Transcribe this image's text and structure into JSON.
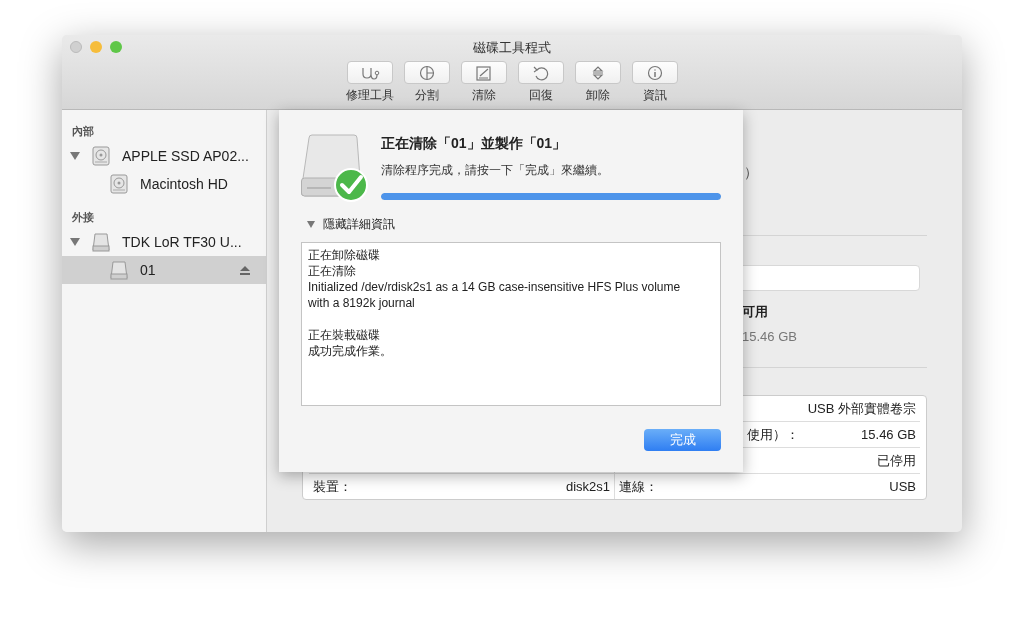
{
  "window": {
    "title": "磁碟工具程式"
  },
  "toolbar": [
    {
      "kind": "firstaid",
      "label": "修理工具"
    },
    {
      "kind": "partition",
      "label": "分割"
    },
    {
      "kind": "erase",
      "label": "清除"
    },
    {
      "kind": "restore",
      "label": "回復"
    },
    {
      "kind": "unmount",
      "label": "卸除"
    },
    {
      "kind": "info",
      "label": "資訊"
    }
  ],
  "sidebar": {
    "sections": [
      {
        "title": "內部",
        "items": [
          {
            "name": "APPLE SSD AP02...",
            "kind": "internal",
            "expanded": true,
            "selected": false,
            "children": [
              {
                "name": "Macintosh HD",
                "kind": "internal",
                "selected": false
              }
            ]
          }
        ]
      },
      {
        "title": "外接",
        "items": [
          {
            "name": "TDK LoR TF30 U...",
            "kind": "external",
            "expanded": true,
            "selected": false,
            "children": [
              {
                "name": "01",
                "kind": "external",
                "selected": true,
                "ejectable": true
              }
            ]
          }
        ]
      }
    ]
  },
  "background": {
    "subtitle_tail": "）",
    "available_label": "可用",
    "available_value": "15.46 GB",
    "info_rows": [
      {
        "right": {
          "value": "USB 外部實體卷宗"
        }
      },
      {
        "right": {
          "label": "使用）：",
          "value": "15.46 GB"
        }
      },
      {
        "right": {
          "value": "已停用"
        }
      },
      {
        "left": {
          "label": "裝置：",
          "value": "disk2s1"
        },
        "right": {
          "label": "連線：",
          "value": "USB"
        }
      }
    ]
  },
  "sheet": {
    "title": "正在清除「01」並製作「01」",
    "message": "清除程序完成，請按一下「完成」來繼續。",
    "progress": {
      "level": 1
    },
    "details": {
      "label": "隱藏詳細資訊",
      "expanded": true
    },
    "log": [
      [
        "正在卸除磁碟",
        "正在清除",
        "Initialized /dev/rdisk2s1 as a 14 GB case-insensitive HFS Plus volume with a 8192k journal"
      ],
      [
        "正在裝載磁碟",
        "成功完成作業。"
      ]
    ],
    "button": "完成"
  }
}
